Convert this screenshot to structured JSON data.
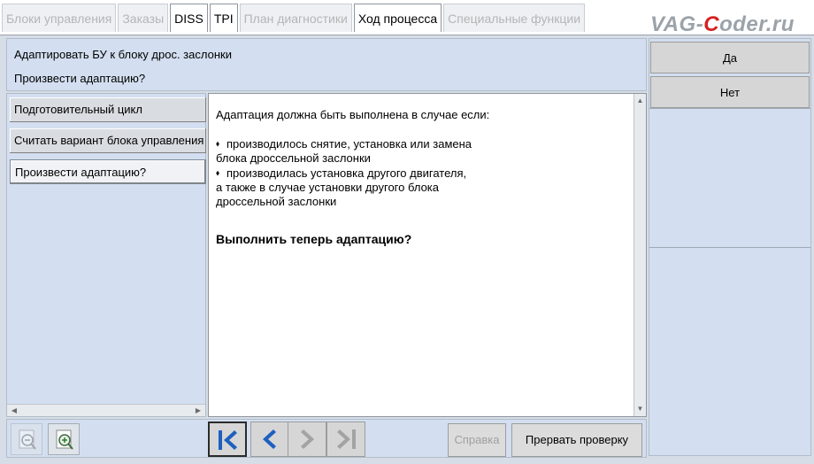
{
  "tabs": [
    {
      "label": "Блоки управления",
      "active": false
    },
    {
      "label": "Заказы",
      "active": false
    },
    {
      "label": "DISS",
      "active": true
    },
    {
      "label": "TPI",
      "active": true
    },
    {
      "label": "План диагностики",
      "active": false
    },
    {
      "label": "Ход процесса",
      "active": true
    },
    {
      "label": "Специальные функции",
      "active": false
    }
  ],
  "brand": {
    "prefix": "VAG-",
    "accent": "C",
    "suffix": "oder.ru"
  },
  "header": {
    "title": "Адаптировать БУ к блоку дрос. заслонки",
    "question": "Произвести адаптацию?"
  },
  "answers": {
    "yes": "Да",
    "no": "Нет"
  },
  "steps": [
    "Подготовительный цикл",
    "Считать вариант блока управления",
    "Произвести адаптацию?"
  ],
  "content": {
    "intro": "Адаптация должна быть выполнена в случае если:",
    "bullet1_line1": "производилось снятие, установка или замена",
    "bullet1_line2": "блока дроссельной заслонки",
    "bullet2_line1": "производилась установка другого двигателя,",
    "bullet2_line2": "а также в случае установки другого блока",
    "bullet2_line3": "дроссельной заслонки",
    "question": "Выполнить теперь адаптацию?"
  },
  "toolbar": {
    "help": "Справка",
    "abort": "Прервать проверку"
  },
  "colors": {
    "accent_red": "#d81f1f",
    "nav_blue": "#1f5fbf",
    "panel_bg": "#d3dff0"
  },
  "icons": [
    "zoom-out-icon",
    "zoom-in-icon",
    "first-icon",
    "prev-icon",
    "next-icon",
    "last-icon",
    "bullet-icon"
  ]
}
